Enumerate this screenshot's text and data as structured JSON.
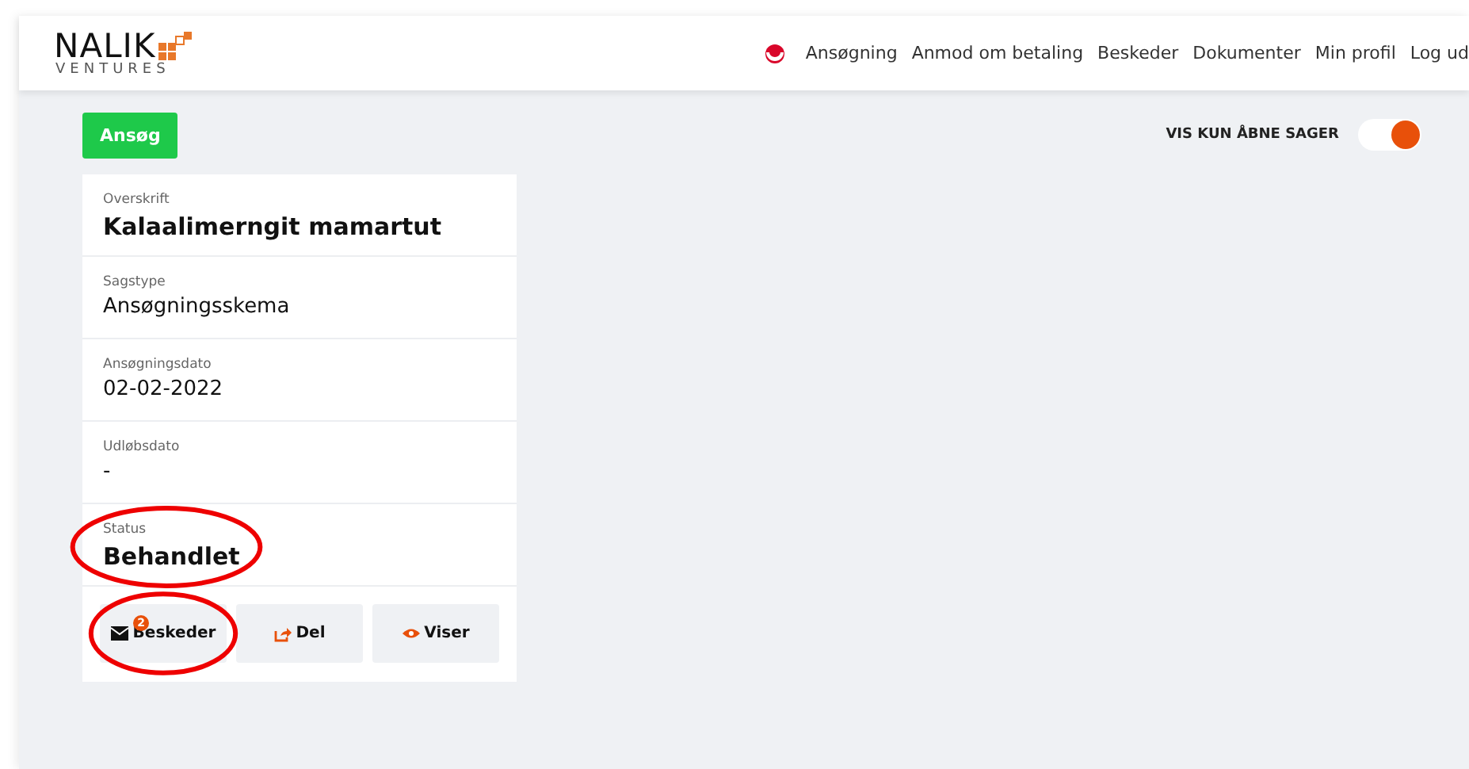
{
  "header": {
    "logo": {
      "name": "NALIK",
      "tagline": "VENTURES"
    },
    "nav": [
      {
        "label": "Ansøgning"
      },
      {
        "label": "Anmod om betaling"
      },
      {
        "label": "Beskeder"
      },
      {
        "label": "Dokumenter"
      },
      {
        "label": "Min profil"
      },
      {
        "label": "Log ud"
      }
    ]
  },
  "apply_button": "Ansøg",
  "filter_toggle": {
    "label": "VIS KUN ÅBNE SAGER",
    "on": true
  },
  "case_card": {
    "fields": [
      {
        "label": "Overskrift",
        "value": "Kalaalimerngit mamartut",
        "kind": "heading",
        "circled": false
      },
      {
        "label": "Sagstype",
        "value": "Ansøgningsskema",
        "kind": "plain",
        "circled": false
      },
      {
        "label": "Ansøgningsdato",
        "value": "02-02-2022",
        "kind": "plain",
        "circled": false
      },
      {
        "label": "Udløbsdato",
        "value": "-",
        "kind": "plain",
        "circled": false
      },
      {
        "label": "Status",
        "value": "Behandlet",
        "kind": "heading",
        "circled": true
      }
    ],
    "actions": [
      {
        "label": "Beskeder",
        "kind": "messages",
        "badge": "2",
        "circled": true
      },
      {
        "label": "Del",
        "kind": "share",
        "circled": false
      },
      {
        "label": "Viser",
        "kind": "view",
        "circled": false
      }
    ]
  }
}
